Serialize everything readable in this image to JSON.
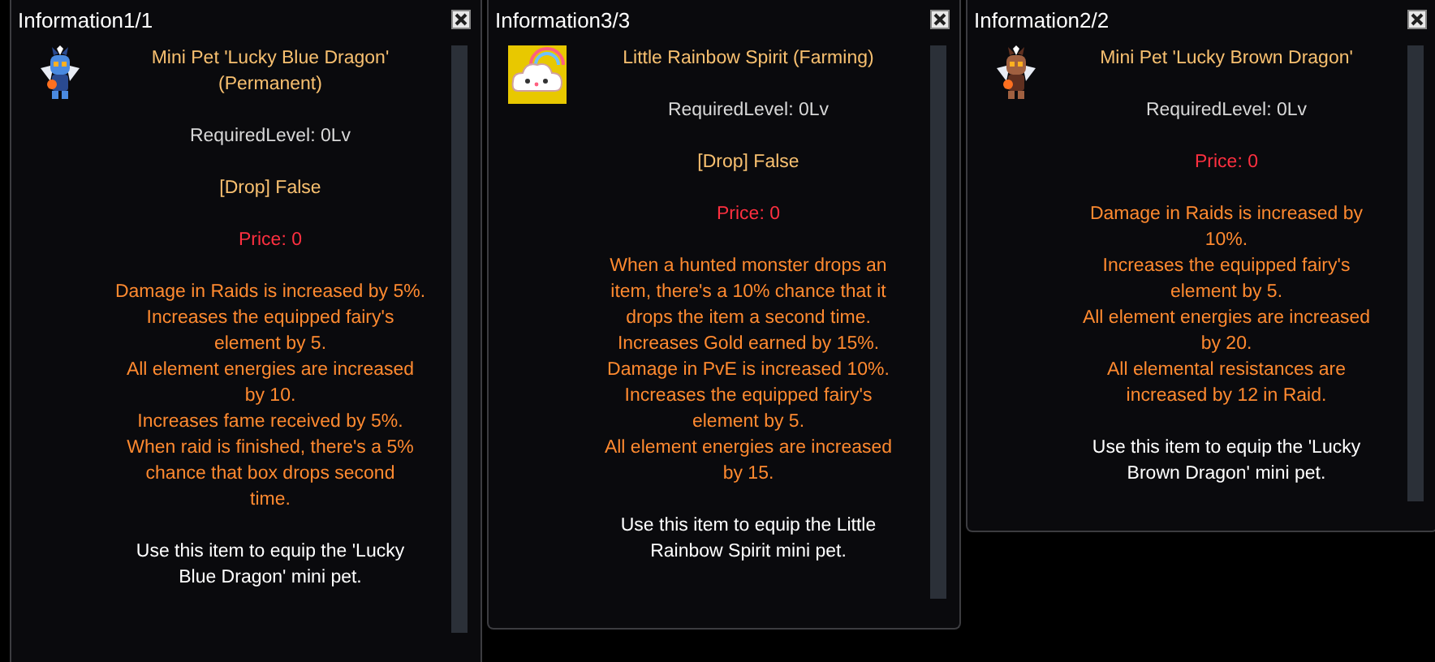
{
  "windows": [
    {
      "title": "Information1/1",
      "paragraphs": [
        {
          "kind": "name",
          "text": "Mini Pet 'Lucky Blue Dragon'\n(Permanent)"
        },
        {
          "kind": "level",
          "text": "RequiredLevel: 0Lv"
        },
        {
          "kind": "drop",
          "text": "[Drop] False"
        },
        {
          "kind": "price",
          "text": "Price: 0"
        },
        {
          "kind": "effects",
          "text": "Damage in Raids is increased by 5%.\nIncreases the equipped fairy's\nelement by 5.\nAll element energies are increased\nby 10.\nIncreases fame received by 5%.\nWhen raid is finished, there's a 5%\nchance that box drops second\ntime."
        },
        {
          "kind": "usage",
          "text": "Use this item to equip the 'Lucky\nBlue Dragon' mini pet."
        }
      ]
    },
    {
      "title": "Information3/3",
      "paragraphs": [
        {
          "kind": "name",
          "text": "Little Rainbow Spirit (Farming)"
        },
        {
          "kind": "level",
          "text": "RequiredLevel: 0Lv"
        },
        {
          "kind": "drop",
          "text": "[Drop] False"
        },
        {
          "kind": "price",
          "text": "Price: 0"
        },
        {
          "kind": "effects",
          "text": "When a hunted monster drops an\nitem, there's a 10% chance that it\ndrops the item a second time.\nIncreases Gold earned by 15%.\nDamage in PvE is increased 10%.\nIncreases the equipped fairy's\nelement by 5.\nAll element energies are increased\nby 15."
        },
        {
          "kind": "usage",
          "text": "Use this item to equip the Little\nRainbow Spirit mini pet."
        }
      ]
    },
    {
      "title": "Information2/2",
      "paragraphs": [
        {
          "kind": "name",
          "text": "Mini Pet 'Lucky Brown Dragon'"
        },
        {
          "kind": "level",
          "text": "RequiredLevel: 0Lv"
        },
        {
          "kind": "price",
          "text": "Price: 0"
        },
        {
          "kind": "effects",
          "text": "Damage in Raids is increased by\n10%.\nIncreases the equipped fairy's\nelement by 5.\nAll element energies are increased\nby 20.\nAll elemental resistances are\nincreased by 12 in Raid."
        },
        {
          "kind": "usage",
          "text": "Use this item to equip the 'Lucky\nBrown Dragon' mini pet."
        }
      ]
    }
  ]
}
